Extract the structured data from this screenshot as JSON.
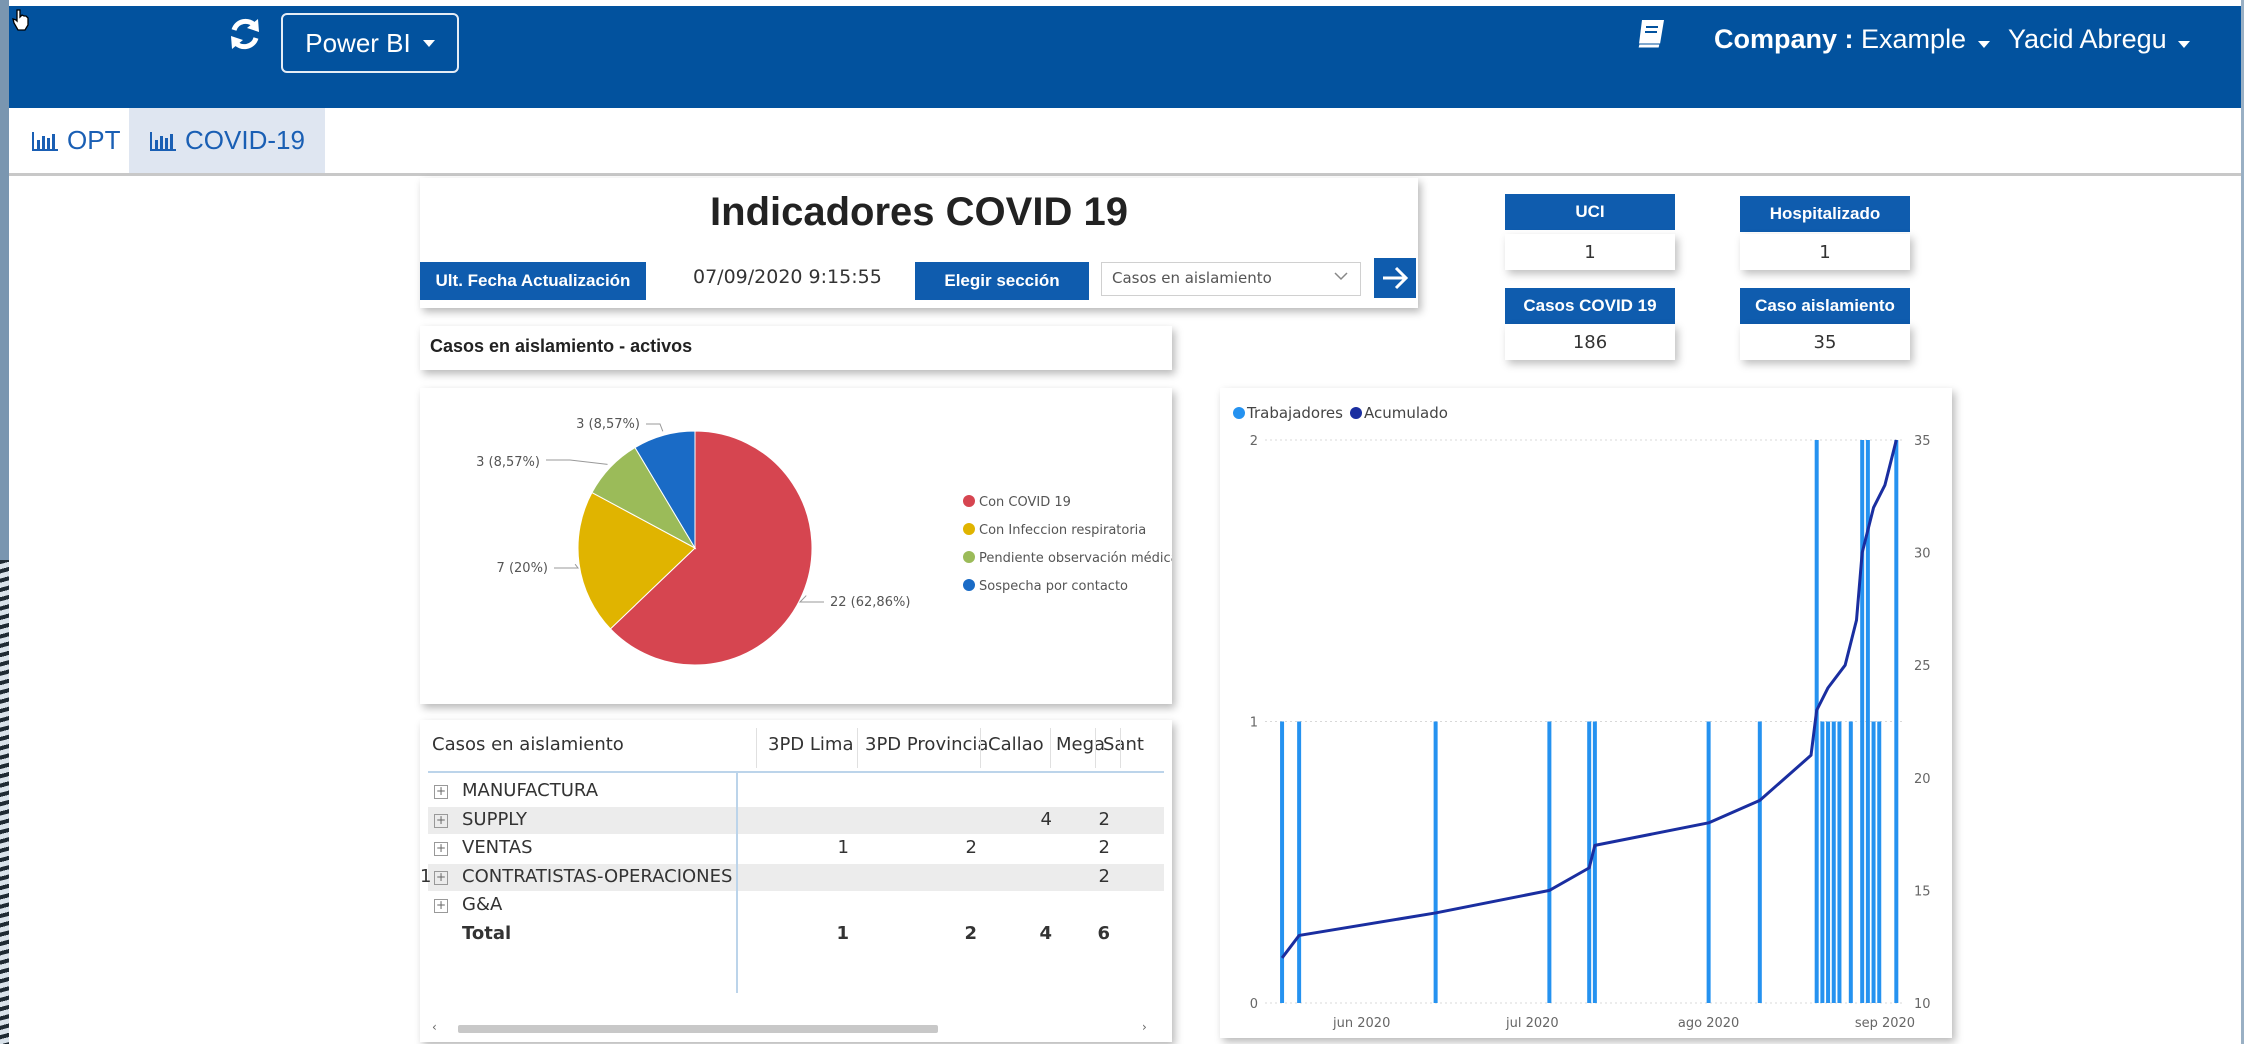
{
  "topbar": {
    "app_button": "Power BI",
    "company_label": "Company :",
    "company_value": "Example",
    "user_name": "Yacid Abregu"
  },
  "tabs": [
    {
      "label": "OPT"
    },
    {
      "label": "COVID-19"
    }
  ],
  "report": {
    "title": "Indicadores COVID 19",
    "update_label": "Ult. Fecha Actualización",
    "update_value": "07/09/2020 9:15:55",
    "section_label": "Elegir sección",
    "section_value": "Casos en aislamiento",
    "subtitle": "Casos en aislamiento - activos"
  },
  "kpis": [
    {
      "label": "UCI",
      "value": "1"
    },
    {
      "label": "Hospitalizado",
      "value": "1"
    },
    {
      "label": "Casos COVID 19",
      "value": "186"
    },
    {
      "label": "Caso aislamiento",
      "value": "35"
    }
  ],
  "colors": {
    "topbar": "#02529e",
    "accent": "#0f5cae",
    "pie": [
      "#d64550",
      "#e0b400",
      "#9bbb59",
      "#1a6bc6"
    ],
    "bars": "#2592f0",
    "line": "#1a2ea0"
  },
  "chart_data": [
    {
      "type": "pie",
      "slices": [
        {
          "label": "Con COVID 19",
          "value": 22,
          "text": "22 (62,86%)"
        },
        {
          "label": "Con Infeccion respiratoria",
          "value": 7,
          "text": "7 (20%)"
        },
        {
          "label": "Pendiente observación médica",
          "value": 3,
          "text": "3 (8,57%)"
        },
        {
          "label": "Sospecha por contacto",
          "value": 3,
          "text": "3 (8,57%)"
        }
      ],
      "legend": "right"
    },
    {
      "type": "table",
      "columns": [
        "Casos en aislamiento",
        "3PD Lima",
        "3PD Provincia",
        "Callao",
        "Mega",
        "Sant"
      ],
      "rows": [
        {
          "name": "MANUFACTURA",
          "values": [
            "",
            "",
            "",
            "",
            "",
            ""
          ]
        },
        {
          "name": "SUPPLY",
          "values": [
            "",
            "",
            "",
            "4",
            "2",
            ""
          ]
        },
        {
          "name": "VENTAS",
          "values": [
            "",
            "1",
            "2",
            "",
            "2",
            ""
          ]
        },
        {
          "name": "CONTRATISTAS-OPERACIONES",
          "values": [
            "1",
            "",
            "",
            "",
            "2",
            ""
          ]
        },
        {
          "name": "G&A",
          "values": [
            "",
            "",
            "",
            "",
            "",
            ""
          ]
        }
      ],
      "total": {
        "name": "Total",
        "values": [
          "1",
          "1",
          "2",
          "4",
          "6",
          ""
        ]
      }
    },
    {
      "type": "bar",
      "series": [
        {
          "name": "Trabajadores",
          "axis": "left",
          "x": [
            "2020-05-18",
            "2020-05-21",
            "2020-06-14",
            "2020-07-04",
            "2020-07-11",
            "2020-07-12",
            "2020-08-01",
            "2020-08-10",
            "2020-08-20",
            "2020-08-21",
            "2020-08-22",
            "2020-08-23",
            "2020-08-24",
            "2020-08-26",
            "2020-08-28",
            "2020-08-29",
            "2020-08-30",
            "2020-08-31",
            "2020-09-03"
          ],
          "values": [
            1,
            1,
            1,
            1,
            1,
            1,
            1,
            1,
            2,
            1,
            1,
            1,
            1,
            1,
            2,
            2,
            1,
            1,
            2
          ]
        },
        {
          "name": "Acumulado",
          "axis": "right",
          "type": "line",
          "x": [
            "2020-05-18",
            "2020-05-21",
            "2020-06-14",
            "2020-07-04",
            "2020-07-11",
            "2020-07-12",
            "2020-08-01",
            "2020-08-10",
            "2020-08-19",
            "2020-08-20",
            "2020-08-22",
            "2020-08-25",
            "2020-08-27",
            "2020-08-28",
            "2020-08-30",
            "2020-09-01",
            "2020-09-03"
          ],
          "values": [
            12,
            13,
            14,
            15,
            16,
            17,
            18,
            19,
            21,
            23,
            24,
            25,
            27,
            30,
            32,
            33,
            35
          ]
        }
      ],
      "x_ticks": [
        "jun 2020",
        "jul 2020",
        "ago 2020",
        "sep 2020"
      ],
      "x_tick_dates": [
        "2020-06-01",
        "2020-07-01",
        "2020-08-01",
        "2020-09-01"
      ],
      "x_range": [
        "2020-05-15",
        "2020-09-04"
      ],
      "y_left_ticks": [
        "0",
        "1",
        "2"
      ],
      "y_left_range": [
        0,
        2
      ],
      "y_right_ticks": [
        "10",
        "15",
        "20",
        "25",
        "30",
        "35"
      ],
      "y_right_range": [
        10,
        35
      ],
      "legend": "top-left"
    }
  ]
}
